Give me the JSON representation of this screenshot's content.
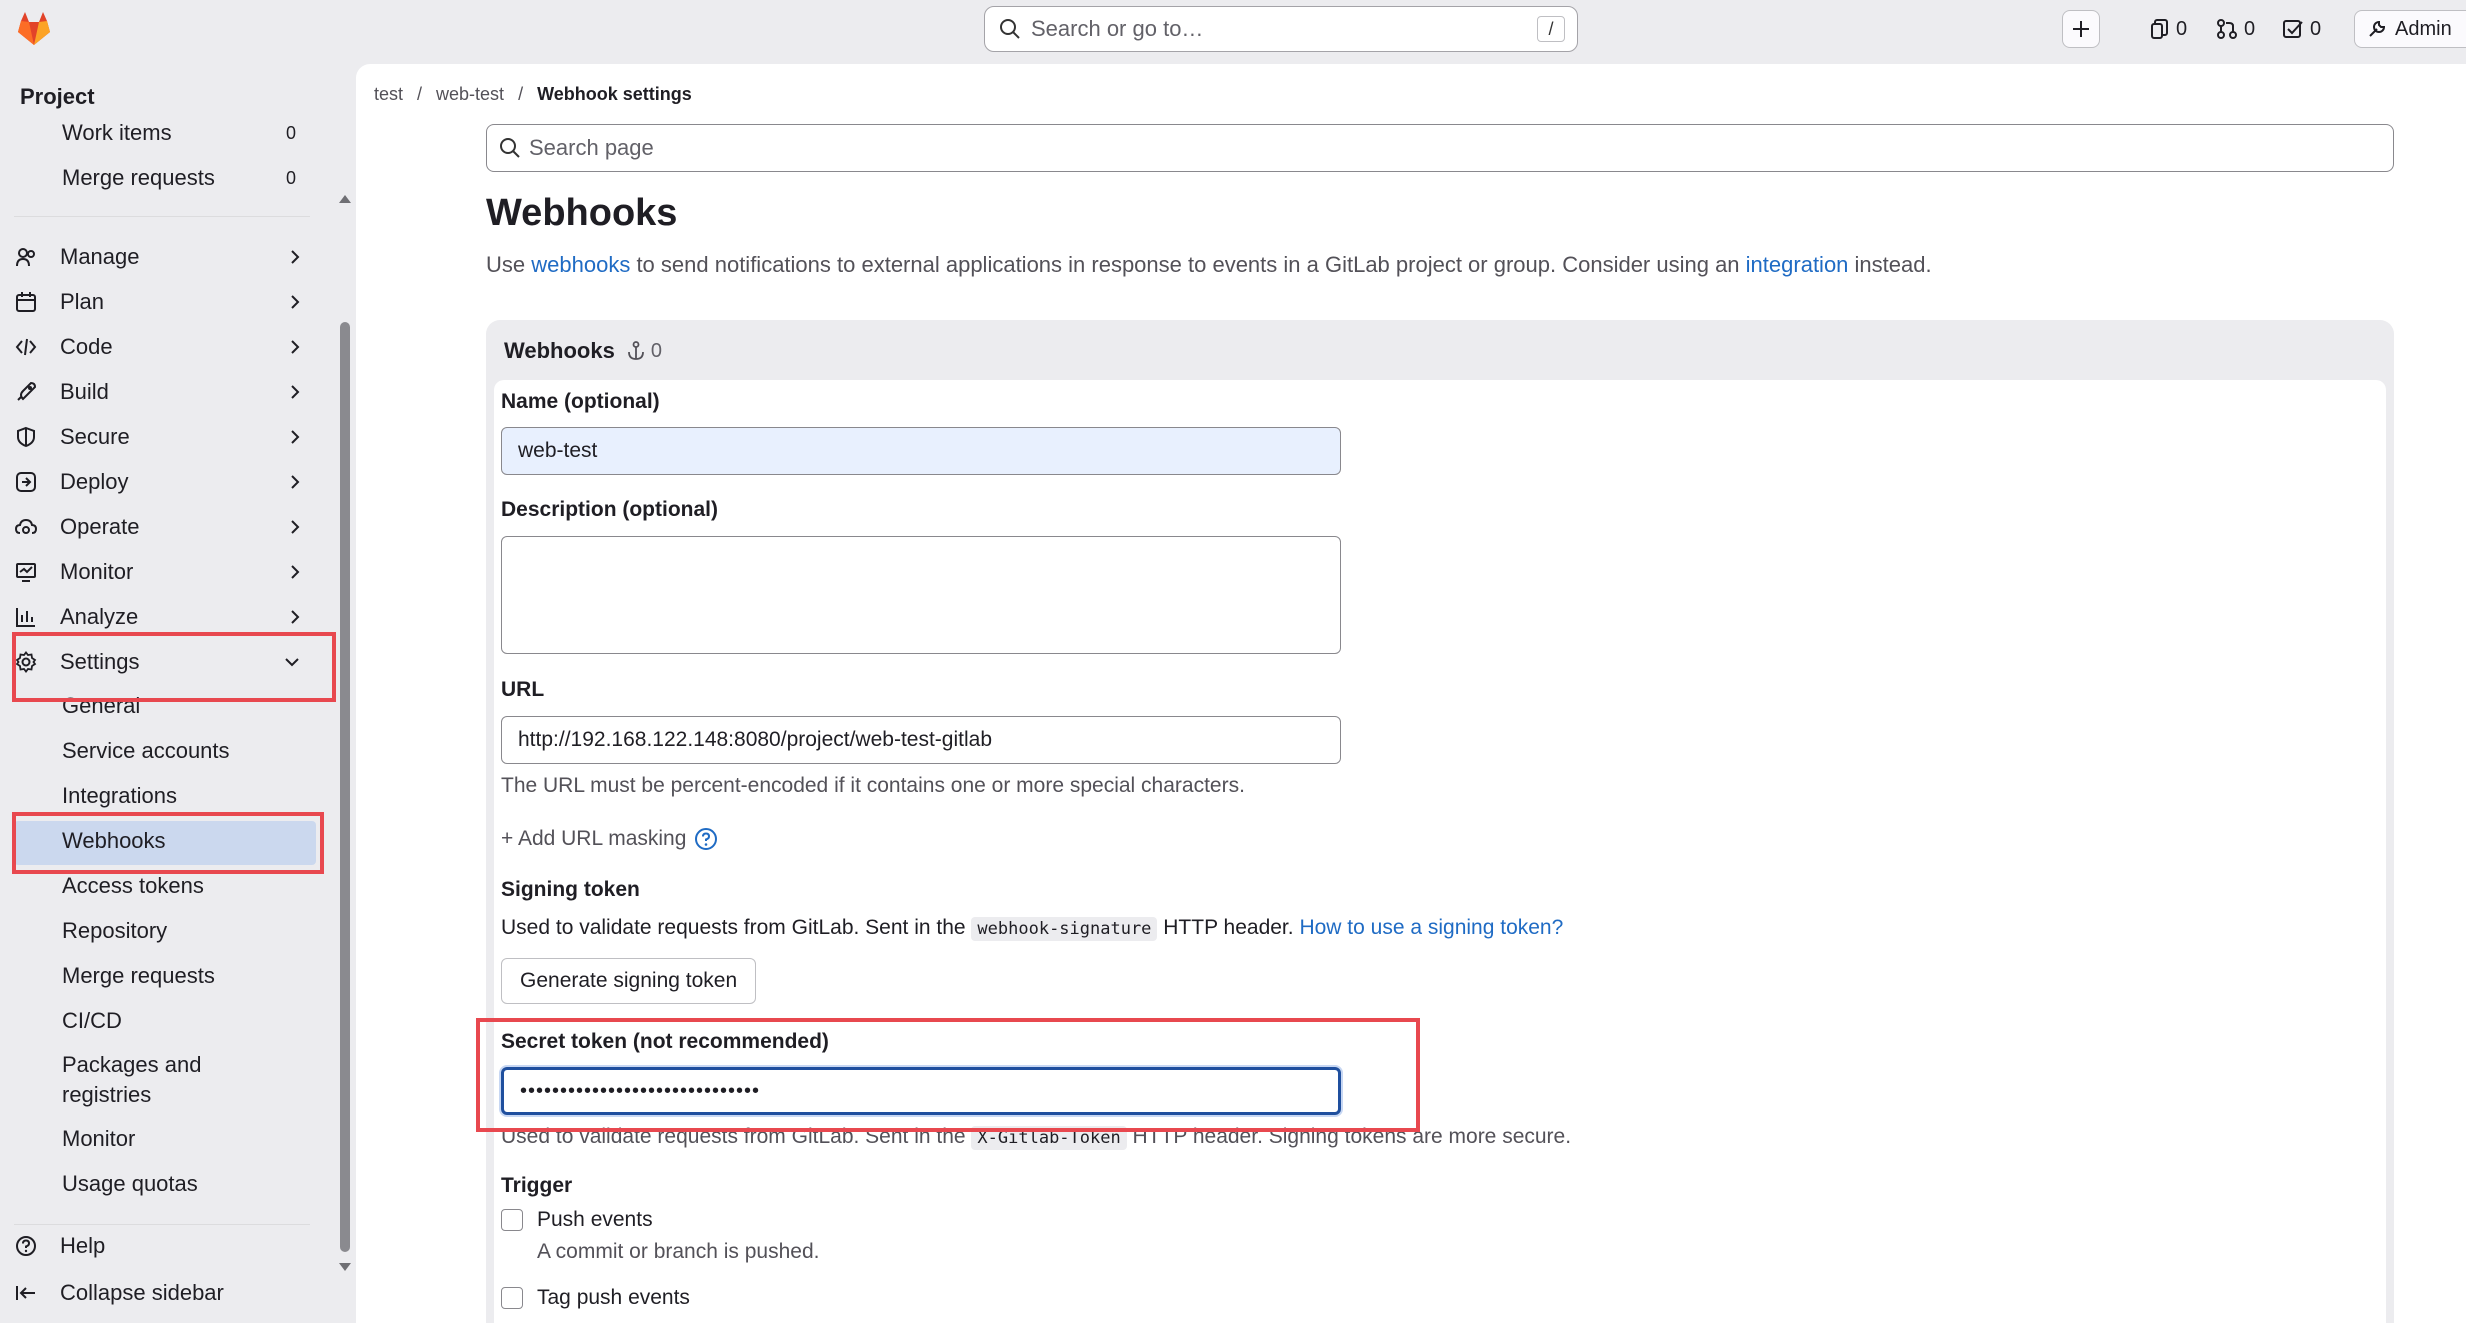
{
  "topbar": {
    "search_placeholder": "Search or go to…",
    "search_shortcut": "/",
    "issues_count": "0",
    "mr_count": "0",
    "todo_count": "0",
    "admin_label": "Admin"
  },
  "sidebar": {
    "project_label": "Project",
    "top_items": [
      {
        "label": "Work items",
        "count": "0"
      },
      {
        "label": "Merge requests",
        "count": "0"
      }
    ],
    "nav": [
      {
        "label": "Manage",
        "icon": "users-icon"
      },
      {
        "label": "Plan",
        "icon": "calendar-icon"
      },
      {
        "label": "Code",
        "icon": "code-icon"
      },
      {
        "label": "Build",
        "icon": "rocket-icon"
      },
      {
        "label": "Secure",
        "icon": "shield-icon"
      },
      {
        "label": "Deploy",
        "icon": "deploy-icon"
      },
      {
        "label": "Operate",
        "icon": "cloud-gear-icon"
      },
      {
        "label": "Monitor",
        "icon": "monitor-icon"
      },
      {
        "label": "Analyze",
        "icon": "chart-icon"
      },
      {
        "label": "Settings",
        "icon": "gear-icon"
      }
    ],
    "settings_sub": [
      "General",
      "Service accounts",
      "Integrations",
      "Webhooks",
      "Access tokens",
      "Repository",
      "Merge requests",
      "CI/CD",
      "Packages and",
      "registries",
      "Monitor",
      "Usage quotas"
    ],
    "help_label": "Help",
    "collapse_label": "Collapse sidebar"
  },
  "breadcrumb": [
    "test",
    "web-test",
    "Webhook settings"
  ],
  "breadcrumb_sep": "/",
  "main": {
    "search_placeholder": "Search page",
    "title": "Webhooks",
    "desc_pre": "Use ",
    "desc_link1": "webhooks",
    "desc_mid": " to send notifications to external applications in response to events in a GitLab project or group. Consider using an ",
    "desc_link2": "integration",
    "desc_post": " instead."
  },
  "card": {
    "header": "Webhooks",
    "count": "0"
  },
  "form": {
    "name_label": "Name (optional)",
    "name_value": "web-test",
    "desc_label": "Description (optional)",
    "url_label": "URL",
    "url_value": "http://192.168.122.148:8080/project/web-test-gitlab",
    "url_help": "The URL must be percent-encoded if it contains one or more special characters.",
    "add_masking": "+ Add URL masking",
    "signing_label": "Signing token",
    "signing_help_pre": "Used to validate requests from GitLab. Sent in the ",
    "signing_code": "webhook-signature",
    "signing_help_post": " HTTP header. ",
    "signing_link": "How to use a signing token?",
    "generate_btn": "Generate signing token",
    "secret_label": "Secret token (not recommended)",
    "secret_value": "••••••••••••••••••••••••••••••",
    "secret_help_pre": "Used to validate requests from GitLab. Sent in the ",
    "secret_code": "X-Gitlab-Token",
    "secret_help_post": " HTTP header. Signing tokens are more secure.",
    "trigger_label": "Trigger",
    "push_label": "Push events",
    "push_help": "A commit or branch is pushed.",
    "tag_label": "Tag push events"
  },
  "colors": {
    "highlight": "#e8484f",
    "link": "#1f6bc4",
    "active_bg": "#cbd8ee"
  }
}
